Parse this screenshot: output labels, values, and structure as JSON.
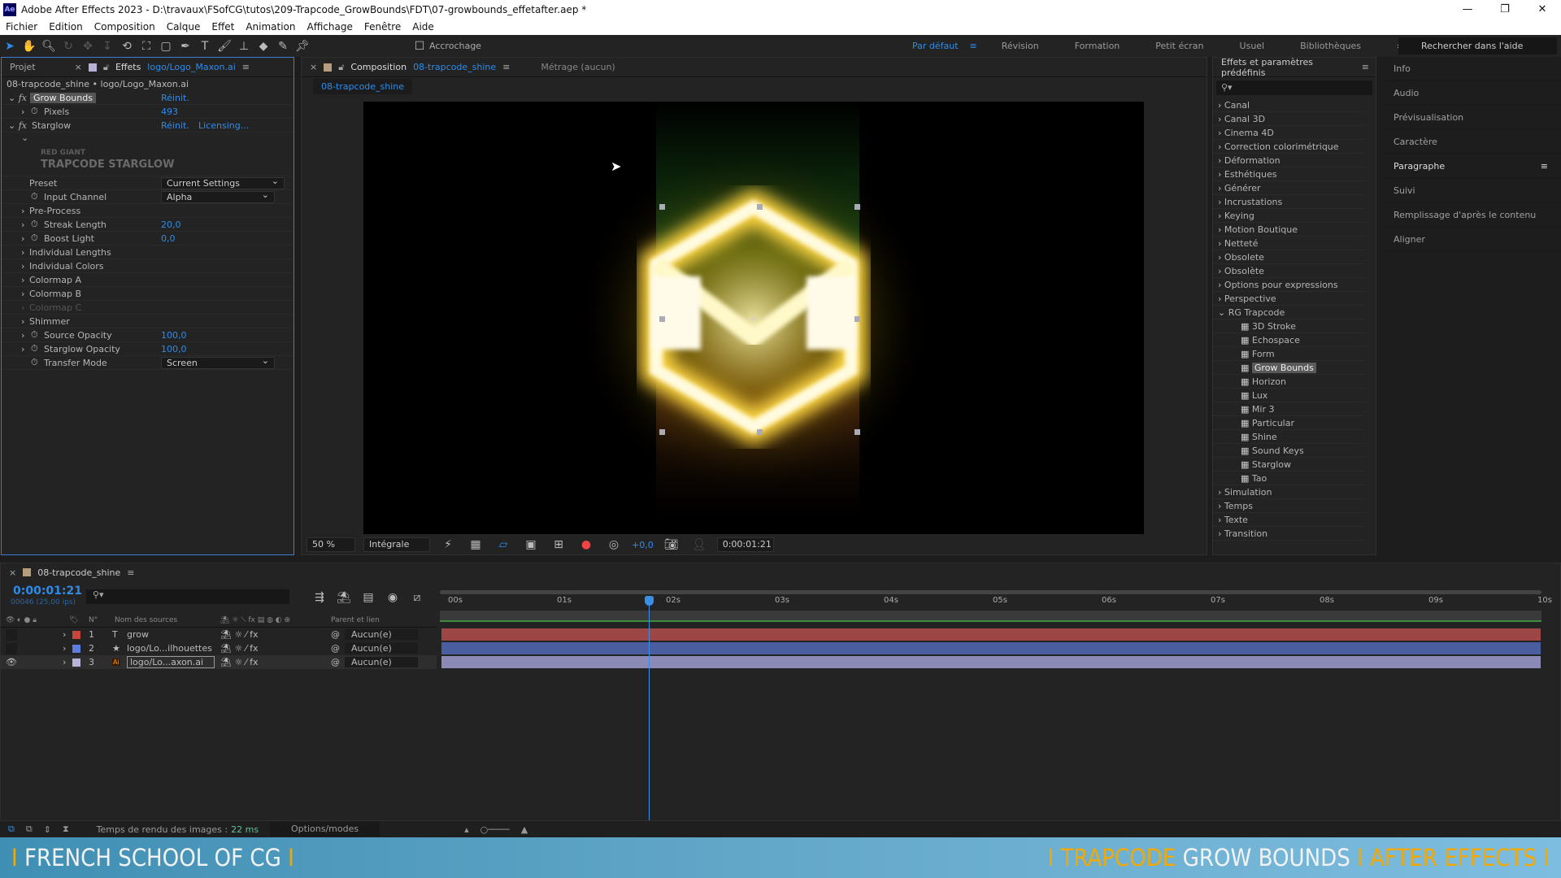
{
  "window": {
    "app_icon": "Ae",
    "title": "Adobe After Effects 2023 - D:\\travaux\\FSofCG\\tutos\\209-Trapcode_GrowBounds\\FDT\\07-growbounds_effetafter.aep *",
    "controls": [
      "—",
      "❐",
      "✕"
    ]
  },
  "menu": [
    "Fichier",
    "Edition",
    "Composition",
    "Calque",
    "Effet",
    "Animation",
    "Affichage",
    "Fenêtre",
    "Aide"
  ],
  "toolbar": {
    "snapping_label": "Accrochage",
    "workspaces": [
      "Par défaut",
      "Révision",
      "Formation",
      "Petit écran",
      "Usuel",
      "Bibliothèques"
    ],
    "active_workspace": "Par défaut",
    "more": "»",
    "help_search_placeholder": "Rechercher dans l'aide"
  },
  "effects_panel": {
    "tab_project": "Projet",
    "tab_effects": "Effets",
    "tab_effects_layer": "logo/Logo_Maxon.ai",
    "breadcrumb": "08-trapcode_shine • logo/Logo_Maxon.ai",
    "grow_bounds": {
      "name": "Grow Bounds",
      "reset": "Réinit.",
      "pixels_label": "Pixels",
      "pixels_value": "493"
    },
    "starglow": {
      "name": "Starglow",
      "reset": "Réinit.",
      "licensing": "Licensing...",
      "logo_line1": "RED GIANT",
      "logo_line2": "TRAPCODE STARGLOW",
      "params": [
        {
          "label": "Preset",
          "dropdown": "Current Settings",
          "stopwatch": false,
          "arrow": false
        },
        {
          "label": "Input Channel",
          "dropdown": "Alpha",
          "stopwatch": true,
          "arrow": false
        },
        {
          "label": "Pre-Process",
          "stopwatch": false,
          "arrow": true
        },
        {
          "label": "Streak Length",
          "value": "20,0",
          "stopwatch": true,
          "arrow": true
        },
        {
          "label": "Boost Light",
          "value": "0,0",
          "stopwatch": true,
          "arrow": true
        },
        {
          "label": "Individual Lengths",
          "stopwatch": false,
          "arrow": true
        },
        {
          "label": "Individual Colors",
          "stopwatch": false,
          "arrow": true
        },
        {
          "label": "Colormap A",
          "stopwatch": false,
          "arrow": true
        },
        {
          "label": "Colormap B",
          "stopwatch": false,
          "arrow": true
        },
        {
          "label": "Colormap C",
          "stopwatch": false,
          "arrow": true,
          "disabled": true
        },
        {
          "label": "Shimmer",
          "stopwatch": false,
          "arrow": true
        },
        {
          "label": "Source Opacity",
          "value": "100,0",
          "stopwatch": true,
          "arrow": true
        },
        {
          "label": "Starglow Opacity",
          "value": "100,0",
          "stopwatch": true,
          "arrow": true
        },
        {
          "label": "Transfer Mode",
          "dropdown": "Screen",
          "stopwatch": true,
          "arrow": false
        }
      ]
    }
  },
  "viewer": {
    "tab_label": "Composition",
    "comp_name": "08-trapcode_shine",
    "footage_tab": "Métrage  (aucun)",
    "subtab": "08-trapcode_shine",
    "zoom": "50 %",
    "resolution": "Intégrale",
    "exposure": "+0,0",
    "timecode": "0:00:01:21"
  },
  "presets_panel": {
    "title": "Effets et paramètres prédéfinis",
    "search_placeholder": "",
    "categories": [
      "Canal",
      "Canal 3D",
      "Cinema 4D",
      "Correction colorimétrique",
      "Déformation",
      "Esthétiques",
      "Générer",
      "Incrustations",
      "Keying",
      "Motion Boutique",
      "Netteté",
      "Obsolete",
      "Obsolète",
      "Options pour expressions",
      "Perspective"
    ],
    "open_category": "RG Trapcode",
    "trapcode_effects": [
      "3D Stroke",
      "Echospace",
      "Form",
      "Grow Bounds",
      "Horizon",
      "Lux",
      "Mir 3",
      "Particular",
      "Shine",
      "Sound Keys",
      "Starglow",
      "Tao"
    ],
    "selected_effect": "Grow Bounds",
    "categories_after": [
      "Simulation",
      "Temps",
      "Texte",
      "Transition"
    ]
  },
  "right_panels": [
    "Info",
    "Audio",
    "Prévisualisation",
    "Caractère",
    "Paragraphe",
    "Suivi",
    "Remplissage d'après le contenu",
    "Aligner"
  ],
  "timeline": {
    "comp_name": "08-trapcode_shine",
    "timecode": "0:00:01:21",
    "frame_info": "00046 (25,00 ips)",
    "col_num": "N°",
    "col_source": "Nom des sources",
    "col_parent": "Parent et lien",
    "ticks": [
      "00s",
      "01s",
      "02s",
      "03s",
      "04s",
      "05s",
      "06s",
      "07s",
      "08s",
      "09s",
      "10s"
    ],
    "playhead_seconds": 1.84,
    "duration_seconds": 10,
    "layers": [
      {
        "num": "1",
        "type_icon": "T",
        "name": "grow",
        "parent": "Aucun(e)",
        "label_color": "#c6463c",
        "bar_color": "#9c4646",
        "visible": false
      },
      {
        "num": "2",
        "type_icon": "★",
        "name": "logo/Lo...ilhouettes",
        "parent": "Aucun(e)",
        "label_color": "#5b7ee0",
        "bar_color": "#4a5d9e",
        "visible": false
      },
      {
        "num": "3",
        "type_icon": "Ai",
        "name": "logo/Lo...axon.ai",
        "parent": "Aucun(e)",
        "label_color": "#b5b3d8",
        "bar_color": "#8b89b5",
        "visible": true
      }
    ]
  },
  "status": {
    "render_label": "Temps de rendu des images :",
    "render_value": "22 ms",
    "options": "Options/modes"
  },
  "banner": {
    "left": "FRENCH SCHOOL OF CG",
    "right_1": "TRAPCODE",
    "right_2": "GROW BOUNDS",
    "right_3": "AFTER EFFECTS",
    "separator": "I"
  },
  "colors": {
    "accent": "#2d8ceb",
    "banner_orange": "#f5a800"
  }
}
